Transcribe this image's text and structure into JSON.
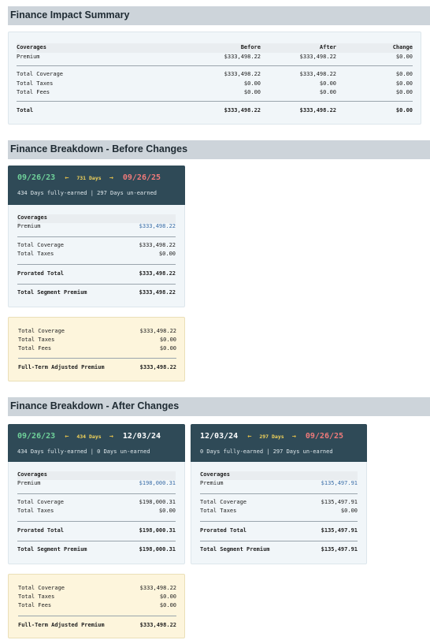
{
  "summary": {
    "title": "Finance Impact Summary",
    "columns": [
      "Coverages",
      "Before",
      "After",
      "Change"
    ],
    "rows": [
      {
        "label": "Premium",
        "before": "$333,498.22",
        "after": "$333,498.22",
        "change": "$0.00"
      },
      {
        "label": "Total Coverage",
        "before": "$333,498.22",
        "after": "$333,498.22",
        "change": "$0.00"
      },
      {
        "label": "Total Taxes",
        "before": "$0.00",
        "after": "$0.00",
        "change": "$0.00"
      },
      {
        "label": "Total Fees",
        "before": "$0.00",
        "after": "$0.00",
        "change": "$0.00"
      },
      {
        "label": "Total",
        "before": "$333,498.22",
        "after": "$333,498.22",
        "change": "$0.00"
      }
    ]
  },
  "before": {
    "title": "Finance Breakdown - Before Changes",
    "segment": {
      "start": "09/26/23",
      "arrow_l": "←",
      "days": "731 Days",
      "arrow_r": "→",
      "end": "09/26/25",
      "sub": "434 Days fully-earned | 297 Days un-earned",
      "coverages_label": "Coverages",
      "premium_label": "Premium",
      "premium": "$333,498.22",
      "total_coverage_label": "Total Coverage",
      "total_coverage": "$333,498.22",
      "total_taxes_label": "Total Taxes",
      "total_taxes": "$0.00",
      "prorated_label": "Prorated Total",
      "prorated": "$333,498.22",
      "segment_premium_label": "Total Segment Premium",
      "segment_premium": "$333,498.22"
    },
    "full_term": {
      "total_coverage_label": "Total Coverage",
      "total_coverage": "$333,498.22",
      "total_taxes_label": "Total Taxes",
      "total_taxes": "$0.00",
      "total_fees_label": "Total Fees",
      "total_fees": "$0.00",
      "adjusted_label": "Full-Term Adjusted Premium",
      "adjusted": "$333,498.22"
    }
  },
  "after": {
    "title": "Finance Breakdown - After Changes",
    "segments": [
      {
        "start": "09/26/23",
        "arrow_l": "←",
        "days": "434 Days",
        "arrow_r": "→",
        "end": "12/03/24",
        "sub": "434 Days fully-earned | 0 Days un-earned",
        "coverages_label": "Coverages",
        "premium_label": "Premium",
        "premium": "$198,000.31",
        "total_coverage_label": "Total Coverage",
        "total_coverage": "$198,000.31",
        "total_taxes_label": "Total Taxes",
        "total_taxes": "$0.00",
        "prorated_label": "Prorated Total",
        "prorated": "$198,000.31",
        "segment_premium_label": "Total Segment Premium",
        "segment_premium": "$198,000.31"
      },
      {
        "start": "12/03/24",
        "arrow_l": "←",
        "days": "297 Days",
        "arrow_r": "→",
        "end": "09/26/25",
        "sub": "0 Days fully-earned | 297 Days un-earned",
        "coverages_label": "Coverages",
        "premium_label": "Premium",
        "premium": "$135,497.91",
        "total_coverage_label": "Total Coverage",
        "total_coverage": "$135,497.91",
        "total_taxes_label": "Total Taxes",
        "total_taxes": "$0.00",
        "prorated_label": "Prorated Total",
        "prorated": "$135,497.91",
        "segment_premium_label": "Total Segment Premium",
        "segment_premium": "$135,497.91"
      }
    ],
    "full_term": {
      "total_coverage_label": "Total Coverage",
      "total_coverage": "$333,498.22",
      "total_taxes_label": "Total Taxes",
      "total_taxes": "$0.00",
      "total_fees_label": "Total Fees",
      "total_fees": "$0.00",
      "adjusted_label": "Full-Term Adjusted Premium",
      "adjusted": "$333,498.22"
    }
  },
  "colors": {
    "header_bg": "#cdd4da",
    "segment_head": "#2f4a57",
    "start_date": "#6fd29a",
    "end_date": "#f07a7a",
    "days": "#f2d35a",
    "premium_link": "#3b6ea8",
    "full_term_bg": "#fdf5dc"
  }
}
